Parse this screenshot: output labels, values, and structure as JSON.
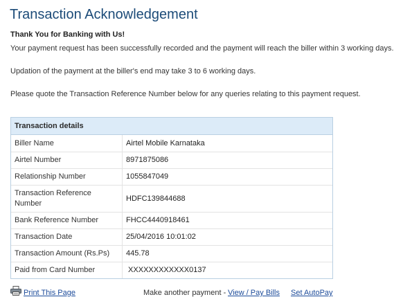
{
  "page": {
    "title": "Transaction Acknowledgement"
  },
  "messages": {
    "thanks": "Thank You for Banking with Us!",
    "line1": "Your payment request has been successfully recorded and the payment will reach the biller within 3 working days.",
    "line2": "Updation of the payment at the biller's end may take 3 to 6 working days.",
    "line3": "Please quote the Transaction Reference Number below for any queries relating to this payment request."
  },
  "details": {
    "header": "Transaction details",
    "rows": [
      {
        "label": "Biller Name",
        "value": "Airtel Mobile Karnataka"
      },
      {
        "label": "Airtel Number",
        "value": "8971875086"
      },
      {
        "label": "Relationship Number",
        "value": "1055847049"
      },
      {
        "label": "Transaction Reference Number",
        "value": "HDFC139844688"
      },
      {
        "label": "Bank Reference Number",
        "value": "FHCC4440918461"
      },
      {
        "label": "Transaction Date",
        "value": "25/04/2016 10:01:02"
      },
      {
        "label": "Transaction Amount (Rs.Ps)",
        "value": "445.78"
      },
      {
        "label": "Paid from Card Number",
        "value": " XXXXXXXXXXXX0137"
      }
    ]
  },
  "footer": {
    "print_label": "Print This Page",
    "another_payment": "Make another payment - ",
    "view_pay_bills": "View / Pay Bills",
    "set_autopay": "Set AutoPay",
    "print_icon": "printer-icon"
  }
}
